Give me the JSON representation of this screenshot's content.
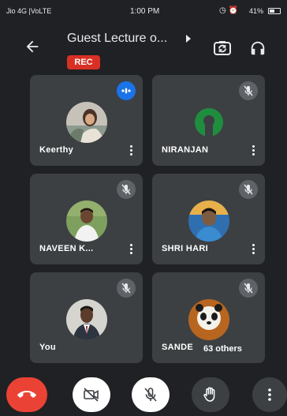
{
  "status_bar": {
    "carrier": "Jio 4G |VoLTE",
    "time": "1:00 PM",
    "battery": "41%"
  },
  "header": {
    "title": "Guest Lecture o...",
    "rec_label": "REC"
  },
  "participants": [
    {
      "name": "Keerthy",
      "state": "speaking"
    },
    {
      "name": "NIRANJAN",
      "state": "muted"
    },
    {
      "name": "NAVEEN K...",
      "state": "muted"
    },
    {
      "name": "SHRI HARI",
      "state": "muted"
    },
    {
      "name": "You",
      "state": "muted"
    },
    {
      "name": "SANDE",
      "state": "muted",
      "overlay": "63 others"
    }
  ],
  "colors": {
    "background": "#202124",
    "tile": "#3c4043",
    "rec": "#d93025",
    "end_call": "#ea4335",
    "speaking": "#1a73e8",
    "niranjan_avatar": "#1e8e3e"
  },
  "controls": {
    "end_call_icon": "phone-hangup-icon",
    "camera_icon": "camera-off-icon",
    "mic_icon": "mic-off-icon",
    "hand_icon": "raise-hand-icon",
    "more_icon": "more-vert-icon"
  }
}
